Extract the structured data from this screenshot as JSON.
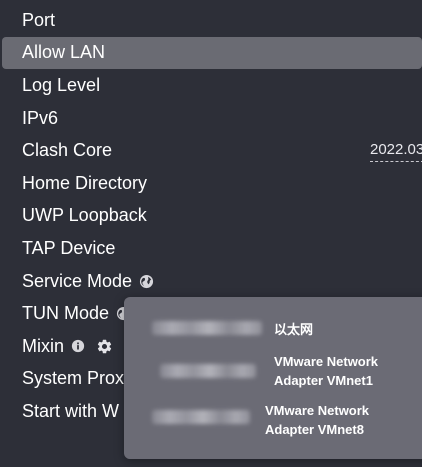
{
  "settings": {
    "items": [
      {
        "label": "Port"
      },
      {
        "label": "Allow LAN"
      },
      {
        "label": "Log Level"
      },
      {
        "label": "IPv6"
      },
      {
        "label": "Clash Core"
      },
      {
        "label": "Home Directory"
      },
      {
        "label": "UWP Loopback"
      },
      {
        "label": "TAP Device"
      },
      {
        "label": "Service Mode"
      },
      {
        "label": "TUN Mode"
      },
      {
        "label": "Mixin"
      },
      {
        "label": "System Prox"
      },
      {
        "label": "Start with W"
      }
    ],
    "clash_core_value": "2022.03",
    "icons": {
      "service_mode": "globe-icon",
      "tun_mode": "globe-icon",
      "mixin_info": "info-icon",
      "mixin_settings": "gear-icon"
    }
  },
  "interfaces_popover": {
    "interfaces": [
      {
        "name": "以太网"
      },
      {
        "name_line1": "VMware Network",
        "name_line2": "Adapter VMnet1"
      },
      {
        "name_line1": "VMware Network",
        "name_line2": "Adapter VMnet8"
      }
    ]
  },
  "colors": {
    "background": "#2d2f38",
    "active_row": "#6a6b73",
    "popover": "#6b6b75",
    "text": "#ffffff"
  }
}
